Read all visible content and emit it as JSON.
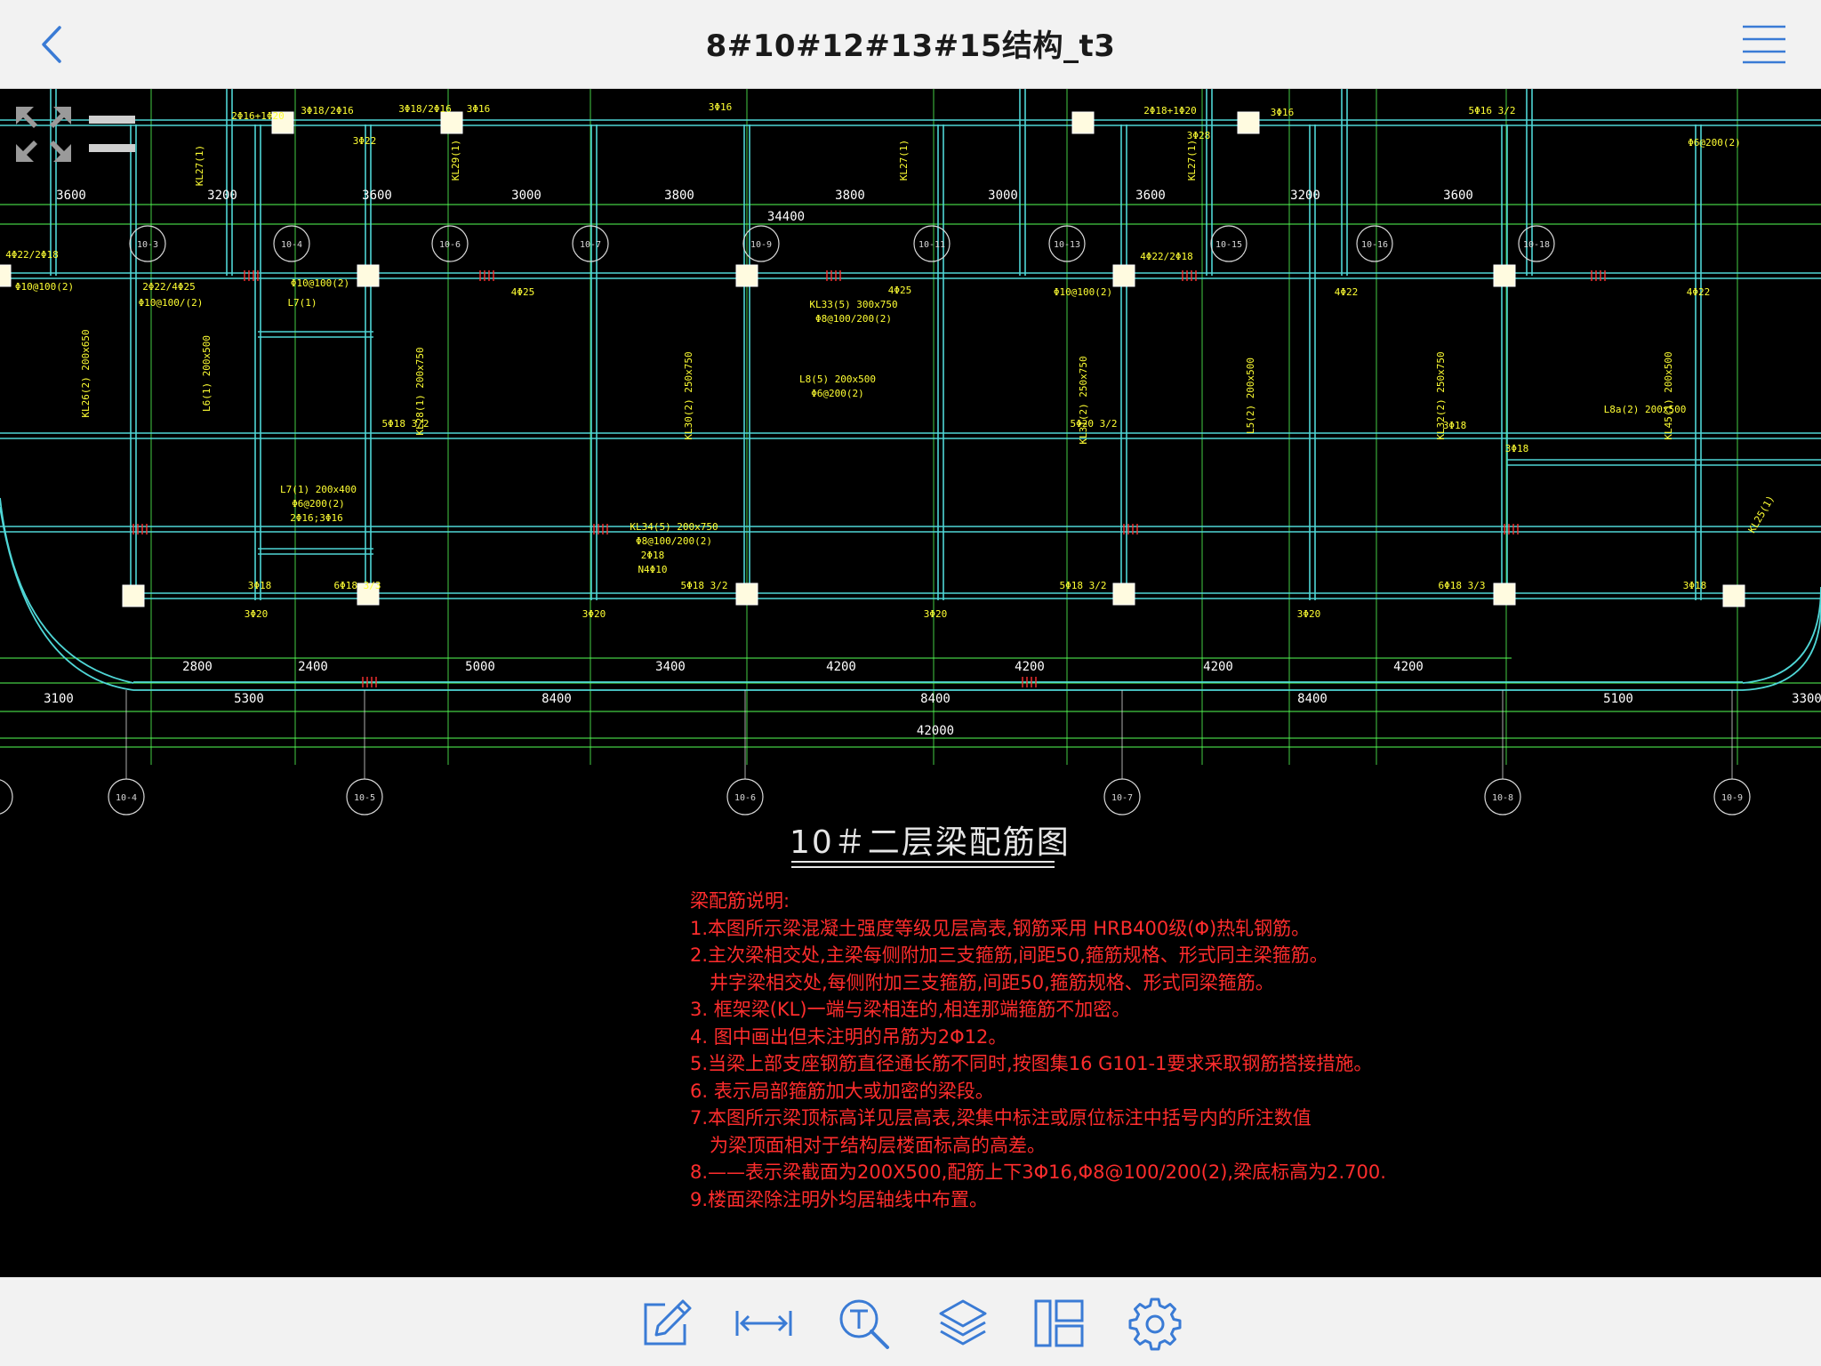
{
  "header": {
    "title": "8#10#12#13#15结构_t3",
    "back_icon": "chevron-left-icon",
    "menu_icon": "hamburger-menu-icon",
    "accent_color": "#3a7bd5"
  },
  "drawing": {
    "title": "10＃二层梁配筋图",
    "colors": {
      "background": "#000000",
      "beam_lines": "#4fd6d6",
      "annotations": "#ffff33",
      "dimensions": "#55ff55",
      "notes": "#ff2d2d"
    },
    "axis_bubbles_top": [
      "10-3",
      "10-4",
      "10-6",
      "10-7",
      "10-9",
      "10-11",
      "10-13",
      "10-15",
      "10-16",
      "10-18"
    ],
    "axis_bubbles_bottom": [
      "10-4",
      "10-5",
      "10-6",
      "10-7",
      "10-8",
      "10-9"
    ],
    "dims_top": [
      "3600",
      "3200",
      "3600",
      "3000",
      "3800",
      "3800",
      "3000",
      "3600",
      "3200",
      "3600"
    ],
    "dim_top_total": "34400",
    "dims_bottom_1": [
      "2800",
      "2400",
      "5000",
      "3400",
      "4200",
      "4200",
      "4200",
      "4200"
    ],
    "dims_bottom_2": [
      "3100",
      "5300",
      "8400",
      "8400",
      "8400",
      "5100",
      "3300"
    ],
    "dim_bottom_total": "42000",
    "beam_labels": [
      "4Φ22/2Φ18",
      "Φ10@100(2)",
      "2Φ22/4Φ25",
      "Φ10@100/(2)",
      "Φ10@100(2)",
      "L7(1)",
      "KL26(2) 200x650",
      "L6(1) 200x500",
      "KL28(1) 200x750",
      "4Φ25",
      "5Φ18 3/2",
      "KL30(2) 250x750",
      "KL33(5) 300x750",
      "Φ8@100/200(2)",
      "4Φ25",
      "L8(5) 200x500",
      "Φ6@200(2)",
      "Φ10@100(2)",
      "KL31(2) 250x750",
      "5Φ20 3/2",
      "4Φ22/2Φ18",
      "L5(2) 200x500",
      "4Φ22",
      "KL32(2) 250x750",
      "3Φ18",
      "4Φ22",
      "KL45(1) 200x500",
      "L8a(2) 200x500",
      "L7(1) 200x400",
      "Φ6@200(2)",
      "2Φ16;3Φ16",
      "KL34(5) 200x750",
      "Φ8@100/200(2)",
      "2Φ18",
      "N4Φ10",
      "3Φ18",
      "6Φ18 3/3",
      "5Φ18 3/2",
      "5Φ18 3/2",
      "6Φ18 3/3",
      "3Φ18",
      "3Φ18",
      "3Φ20",
      "3Φ20",
      "3Φ20",
      "3Φ20",
      "KL25(1)",
      "3Φ22",
      "3Φ16",
      "3Φ18/2Φ16",
      "3Φ16",
      "2Φ18+1Φ20",
      "3Φ28",
      "3Φ16",
      "5Φ16 3/2",
      "Φ6@200(2)",
      "2Φ16+1Φ20",
      "3Φ18/2Φ16",
      "KL27(1)",
      "KL29(1)",
      "KL27(1)",
      "KL27(1)"
    ]
  },
  "notes": {
    "heading": "梁配筋说明:",
    "items": [
      "1.本图所示梁混凝土强度等级见层高表,钢筋采用 HRB400级(Φ)热轧钢筋。",
      "2.主次梁相交处,主梁每侧附加三支箍筋,间距50,箍筋规格、形式同主梁箍筋。",
      "井字梁相交处,每侧附加三支箍筋,间距50,箍筋规格、形式同梁箍筋。",
      "3. 框架梁(KL)一端与梁相连的,相连那端箍筋不加密。",
      "4. 图中画出但未注明的吊筋为2Φ12。",
      "5.当梁上部支座钢筋直径通长筋不同时,按图集16 G101-1要求采取钢筋搭接措施。",
      "6. 表示局部箍筋加大或加密的梁段。",
      "7.本图所示梁顶标高详见层高表,梁集中标注或原位标注中括号内的所注数值",
      "为梁顶面相对于结构层楼面标高的高差。",
      "8.——表示梁截面为200X500,配筋上下3Φ16,Φ8@100/200(2),梁底标高为2.700.",
      "9.楼面梁除注明外均居轴线中布置。"
    ]
  },
  "toolbar": {
    "items": [
      {
        "name": "edit",
        "icon": "pencil-edit-icon"
      },
      {
        "name": "measure",
        "icon": "measure-distance-icon"
      },
      {
        "name": "text-search",
        "icon": "text-search-icon"
      },
      {
        "name": "layers",
        "icon": "layers-icon"
      },
      {
        "name": "layout",
        "icon": "layout-panels-icon"
      },
      {
        "name": "settings",
        "icon": "gear-icon"
      }
    ]
  }
}
